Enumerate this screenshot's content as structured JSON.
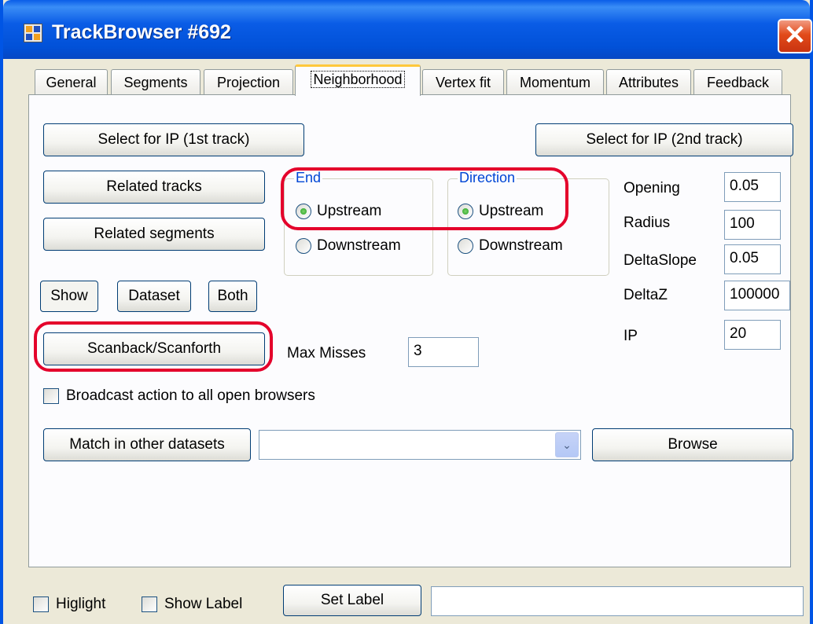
{
  "window": {
    "title": "TrackBrowser #692",
    "close_glyph": "✕"
  },
  "tabs": [
    "General",
    "Segments",
    "Projection",
    "Neighborhood",
    "Vertex fit",
    "Momentum",
    "Attributes",
    "Feedback"
  ],
  "active_tab": "Neighborhood",
  "buttons": {
    "select_ip_1": "Select for IP (1st track)",
    "select_ip_2": "Select for IP (2nd track)",
    "related_tracks": "Related tracks",
    "related_segments": "Related segments",
    "show": "Show",
    "dataset": "Dataset",
    "both": "Both",
    "scanback": "Scanback/Scanforth",
    "match_other": "Match in other datasets",
    "browse": "Browse",
    "set_label": "Set Label"
  },
  "end_group": {
    "legend": "End",
    "options": [
      "Upstream",
      "Downstream"
    ],
    "selected": "Upstream"
  },
  "direction_group": {
    "legend": "Direction",
    "options": [
      "Upstream",
      "Downstream"
    ],
    "selected": "Upstream"
  },
  "params": [
    {
      "label": "Opening",
      "value": "0.05"
    },
    {
      "label": "Radius",
      "value": "100"
    },
    {
      "label": "DeltaSlope",
      "value": "0.05"
    },
    {
      "label": "DeltaZ",
      "value": "100000"
    },
    {
      "label": "IP",
      "value": "20"
    }
  ],
  "max_misses": {
    "label": "Max Misses",
    "value": "3"
  },
  "broadcast": {
    "label": "Broadcast action to all open browsers",
    "checked": false
  },
  "dataset_combo": {
    "value": "",
    "arrow": "⌄"
  },
  "bottom": {
    "highlight_label": "Higlight",
    "show_label_label": "Show Label",
    "label_field": ""
  },
  "colors": {
    "title_bar": "#0a5ce6",
    "highlight_ring": "#e4002b",
    "group_legend": "#0046d5",
    "tab_active_border": "#ffc83c"
  },
  "icons": {
    "app": "app-window-icon",
    "close": "close-icon",
    "dropdown": "chevron-down-icon"
  }
}
